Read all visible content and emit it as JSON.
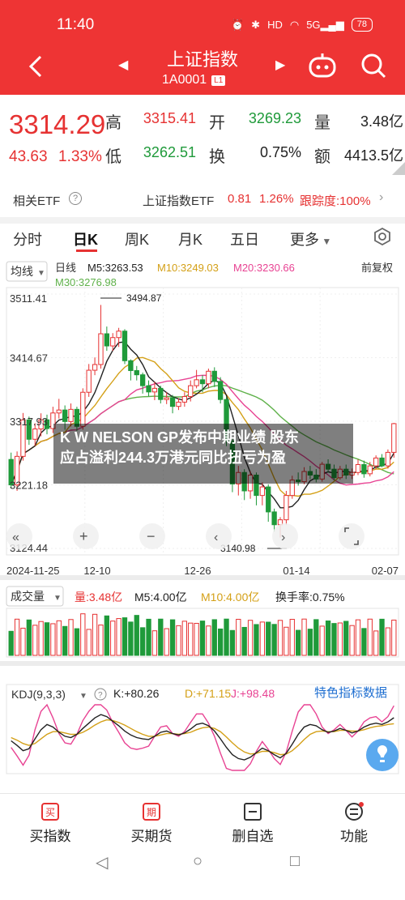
{
  "status_bar": {
    "time": "11:40",
    "battery": "78",
    "icons": [
      "alarm-icon",
      "bluetooth-icon",
      "hd-icon",
      "wifi-icon",
      "signal-5g-icon"
    ]
  },
  "nav": {
    "title": "上证指数",
    "code": "1A0001",
    "code_tag": "L1"
  },
  "quote": {
    "price": "3314.29",
    "change": "43.63",
    "change_pct": "1.33%",
    "high_label": "高",
    "high": "3315.41",
    "open_label": "开",
    "open": "3269.23",
    "vol_label": "量",
    "vol": "3.48亿",
    "low_label": "低",
    "low": "3262.51",
    "turnover_label": "换",
    "turnover": "0.75%",
    "amount_label": "额",
    "amount": "4413.5亿"
  },
  "etf": {
    "label": "相关ETF",
    "help": "?",
    "name": "上证指数ETF",
    "price": "0.81",
    "pct": "1.26%",
    "tracking": "跟踪度:100%"
  },
  "tabs": [
    "分时",
    "日K",
    "周K",
    "月K",
    "五日",
    "更多"
  ],
  "kline": {
    "selector": "均线",
    "period": "日线",
    "ma5": "M5:3263.53",
    "ma10": "M10:3249.03",
    "ma20": "M20:3230.66",
    "ma30": "M30:3276.98",
    "adjust": "前复权",
    "y_labels": [
      "3511.41",
      "3414.67",
      "3317.93",
      "3221.18",
      "3124.44"
    ],
    "high_mark": "3494.87",
    "low_mark": "3140.98",
    "dates": [
      "2024-11-25",
      "12-10",
      "12-26",
      "01-14",
      "02-07"
    ]
  },
  "volume": {
    "selector": "成交量",
    "vol": "量:3.48亿",
    "m5": "M5:4.00亿",
    "m10": "M10:4.00亿",
    "turnover": "换手率:0.75%"
  },
  "kdj": {
    "selector": "KDJ(9,3,3)",
    "k": "K:+80.26",
    "d": "D:+71.15",
    "j": "J:+98.48",
    "special": "特色指标数据"
  },
  "news": {
    "line1": "K W NELSON GP发布中期业绩 股东",
    "line2": "应占溢利244.3万港元同比扭亏为盈"
  },
  "bottom": {
    "buy_index": "买指数",
    "buy_futures": "买期货",
    "remove_watch": "删自选",
    "functions": "功能"
  },
  "colors": {
    "up": "#e63232",
    "down": "#1f9a3a",
    "header": "#ee3434",
    "ma5": "#222222",
    "ma10": "#d4a017",
    "ma20": "#e84393",
    "ma30": "#5fb14a"
  },
  "chart_data": {
    "type": "candlestick",
    "dates": [
      "2024-11-25",
      "12-10",
      "12-26",
      "01-14",
      "02-07"
    ],
    "ylim": [
      3124.44,
      3511.41
    ],
    "y_ticks": [
      3511.41,
      3414.67,
      3317.93,
      3221.18,
      3124.44
    ],
    "annotations": {
      "high": 3494.87,
      "low": 3140.98
    },
    "ma": {
      "M5": 3263.53,
      "M10": 3249.03,
      "M20": 3230.66,
      "M30": 3276.98
    },
    "candles": [
      [
        3259.8,
        3221.1,
        3270.2,
        3215.5
      ],
      [
        3221.1,
        3264.5,
        3272.0,
        3212.0
      ],
      [
        3264.5,
        3320.0,
        3330.5,
        3258.0
      ],
      [
        3320.0,
        3290.5,
        3325.0,
        3282.0
      ],
      [
        3290.5,
        3306.2,
        3315.0,
        3280.5
      ],
      [
        3306.2,
        3320.1,
        3330.0,
        3295.0
      ],
      [
        3320.1,
        3306.8,
        3328.0,
        3298.0
      ],
      [
        3306.8,
        3330.5,
        3340.0,
        3300.0
      ],
      [
        3330.5,
        3335.0,
        3352.0,
        3322.0
      ],
      [
        3335.0,
        3317.5,
        3342.0,
        3305.0
      ],
      [
        3317.5,
        3336.0,
        3345.0,
        3310.0
      ],
      [
        3336.0,
        3310.2,
        3340.0,
        3303.0
      ],
      [
        3310.2,
        3362.0,
        3368.0,
        3305.0
      ],
      [
        3362.0,
        3395.5,
        3405.0,
        3355.0
      ],
      [
        3395.5,
        3404.2,
        3415.0,
        3388.0
      ],
      [
        3404.2,
        3451.0,
        3494.87,
        3398.0
      ],
      [
        3451.0,
        3432.5,
        3462.0,
        3425.0
      ],
      [
        3432.5,
        3445.2,
        3452.0,
        3425.0
      ],
      [
        3445.2,
        3455.0,
        3460.0,
        3431.0
      ],
      [
        3455.0,
        3410.0,
        3458.0,
        3405.0
      ],
      [
        3410.0,
        3395.0,
        3412.0,
        3380.0
      ],
      [
        3395.0,
        3388.6,
        3402.0,
        3380.0
      ],
      [
        3388.6,
        3372.0,
        3392.0,
        3360.0
      ],
      [
        3372.0,
        3362.5,
        3380.0,
        3356.0
      ],
      [
        3362.5,
        3368.0,
        3378.0,
        3350.0
      ],
      [
        3368.0,
        3351.0,
        3372.0,
        3345.0
      ],
      [
        3351.0,
        3353.5,
        3362.0,
        3344.0
      ],
      [
        3353.5,
        3340.5,
        3358.0,
        3330.0
      ],
      [
        3340.5,
        3347.0,
        3353.0,
        3335.0
      ],
      [
        3347.0,
        3355.5,
        3362.0,
        3340.0
      ],
      [
        3355.5,
        3372.0,
        3380.0,
        3348.0
      ],
      [
        3372.0,
        3381.0,
        3396.0,
        3368.0
      ],
      [
        3381.0,
        3375.0,
        3388.0,
        3362.0
      ],
      [
        3375.0,
        3394.0,
        3398.0,
        3368.0
      ],
      [
        3394.0,
        3378.5,
        3400.0,
        3370.0
      ],
      [
        3378.5,
        3351.0,
        3385.0,
        3345.0
      ],
      [
        3351.0,
        3288.0,
        3355.0,
        3280.0
      ],
      [
        3288.0,
        3222.5,
        3292.0,
        3210.0
      ],
      [
        3222.5,
        3240.0,
        3250.0,
        3205.0
      ],
      [
        3240.0,
        3212.0,
        3245.0,
        3198.0
      ],
      [
        3212.0,
        3236.0,
        3242.0,
        3200.0
      ],
      [
        3236.0,
        3205.0,
        3240.0,
        3190.0
      ],
      [
        3205.0,
        3218.0,
        3225.0,
        3190.0
      ],
      [
        3218.0,
        3180.0,
        3222.0,
        3165.0
      ],
      [
        3180.0,
        3160.5,
        3185.0,
        3150.0
      ],
      [
        3160.5,
        3168.0,
        3172.0,
        3140.98
      ],
      [
        3168.0,
        3205.0,
        3212.0,
        3160.0
      ],
      [
        3205.0,
        3228.5,
        3235.0,
        3200.0
      ],
      [
        3228.5,
        3226.0,
        3240.0,
        3220.0
      ],
      [
        3226.0,
        3241.5,
        3248.0,
        3222.0
      ],
      [
        3241.5,
        3236.0,
        3250.0,
        3230.0
      ],
      [
        3236.0,
        3230.0,
        3245.0,
        3225.0
      ],
      [
        3230.0,
        3252.5,
        3256.0,
        3226.0
      ],
      [
        3252.5,
        3245.0,
        3260.0,
        3240.0
      ],
      [
        3245.0,
        3232.0,
        3252.0,
        3228.0
      ],
      [
        3232.0,
        3245.0,
        3250.0,
        3229.0
      ],
      [
        3245.0,
        3236.0,
        3252.0,
        3230.0
      ],
      [
        3236.0,
        3240.0,
        3246.0,
        3230.0
      ],
      [
        3240.0,
        3252.0,
        3260.0,
        3236.0
      ],
      [
        3252.0,
        3238.0,
        3258.0,
        3232.0
      ],
      [
        3238.0,
        3250.0,
        3256.0,
        3234.0
      ],
      [
        3250.0,
        3262.0,
        3266.0,
        3245.0
      ],
      [
        3262.0,
        3250.0,
        3268.0,
        3248.0
      ],
      [
        3250.0,
        3270.6,
        3275.0,
        3246.0
      ],
      [
        3270.6,
        3314.29,
        3315.41,
        3262.51
      ]
    ],
    "kdj": {
      "K": [
        45,
        38,
        30,
        33,
        48,
        62,
        70,
        66,
        58,
        52,
        50,
        55,
        64,
        72,
        80,
        85,
        82,
        75,
        68,
        60,
        54,
        50,
        48,
        47,
        52,
        58,
        60,
        56,
        54,
        57,
        63,
        70,
        72,
        68,
        60,
        48,
        35,
        24,
        18,
        16,
        20,
        27,
        34,
        30,
        24,
        19,
        26,
        40,
        55,
        66,
        70,
        68,
        62,
        58,
        60,
        64,
        61,
        57,
        60,
        66,
        70,
        72,
        70,
        74,
        80.26
      ],
      "D": [
        50,
        46,
        41,
        38,
        41,
        48,
        55,
        59,
        59,
        57,
        55,
        55,
        58,
        63,
        69,
        74,
        77,
        76,
        73,
        69,
        64,
        59,
        55,
        52,
        52,
        54,
        56,
        56,
        55,
        56,
        58,
        62,
        65,
        66,
        64,
        59,
        51,
        42,
        34,
        28,
        25,
        26,
        29,
        29,
        27,
        24,
        25,
        30,
        38,
        47,
        55,
        59,
        60,
        59,
        59,
        61,
        61,
        60,
        60,
        62,
        65,
        67,
        68,
        70,
        71.15
      ],
      "J": [
        35,
        22,
        8,
        23,
        62,
        90,
        100,
        80,
        56,
        42,
        40,
        55,
        76,
        90,
        100,
        100,
        92,
        73,
        58,
        42,
        34,
        32,
        34,
        37,
        52,
        66,
        68,
        56,
        52,
        59,
        73,
        86,
        86,
        72,
        52,
        26,
        3,
        0,
        0,
        0,
        10,
        29,
        44,
        32,
        18,
        9,
        28,
        60,
        89,
        100,
        100,
        86,
        66,
        56,
        62,
        70,
        61,
        51,
        60,
        74,
        80,
        82,
        74,
        82,
        98.48
      ]
    }
  }
}
